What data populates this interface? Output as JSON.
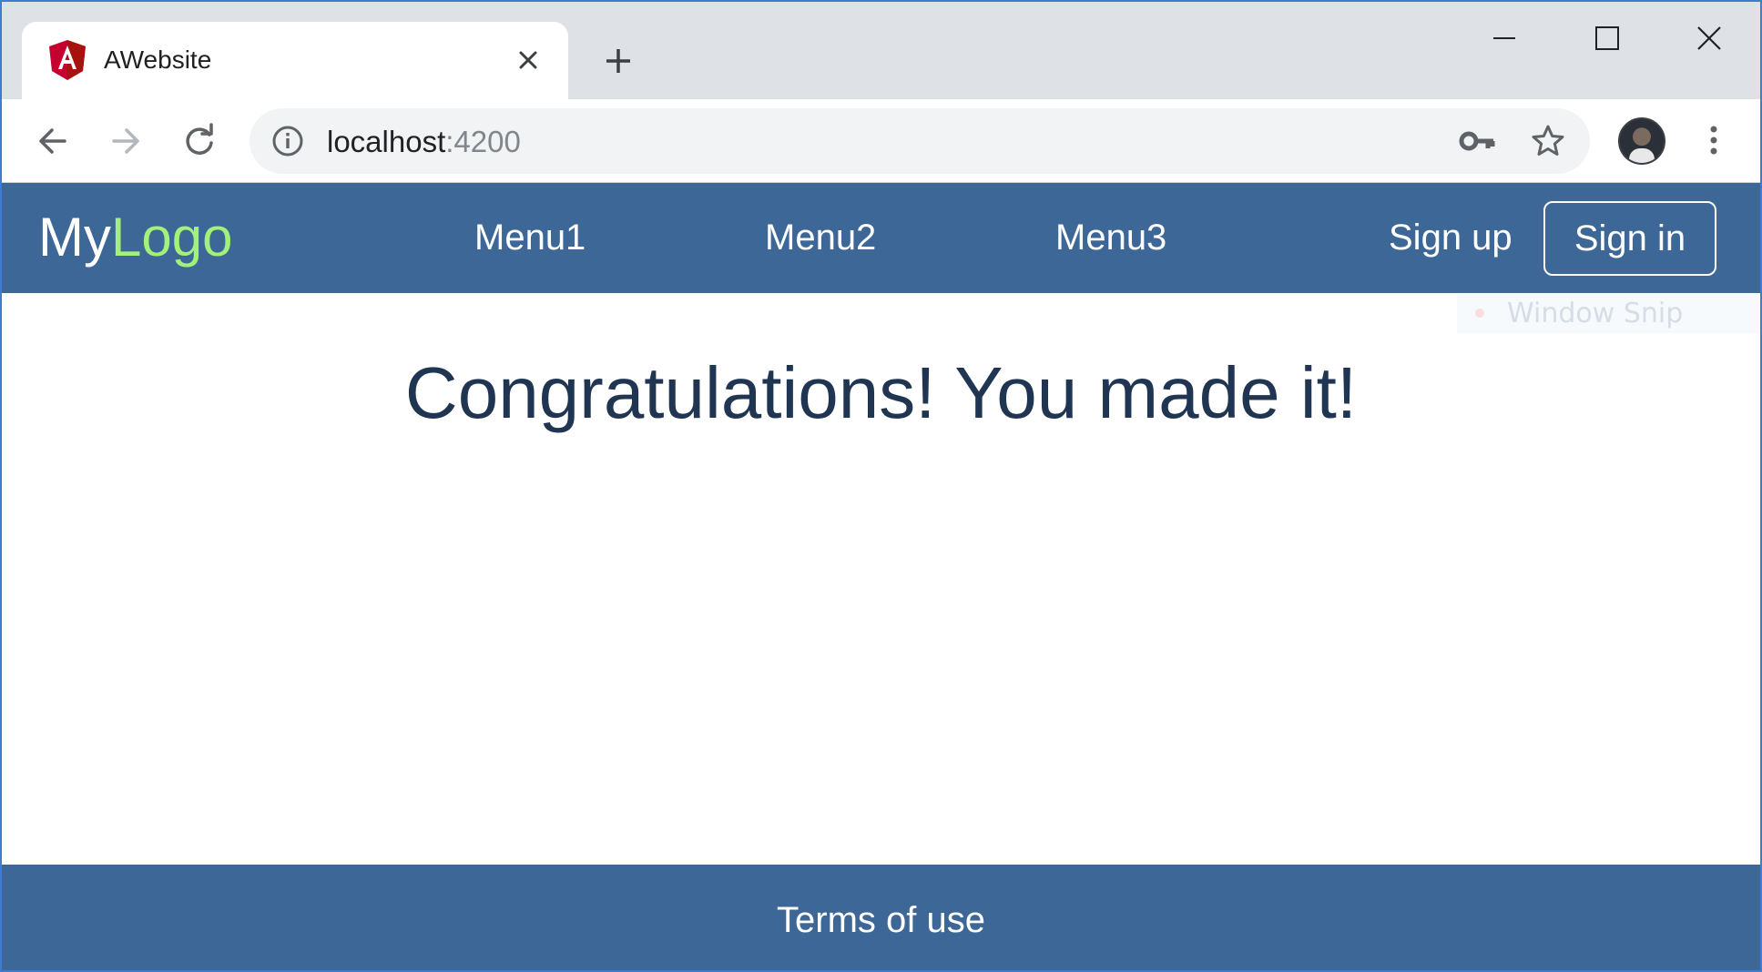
{
  "browser": {
    "tab": {
      "title": "AWebsite",
      "favicon": "angular-icon"
    },
    "address_bar": {
      "host": "localhost",
      "port": ":4200"
    },
    "toolbar_icons": [
      "back-arrow-icon",
      "forward-arrow-icon",
      "reload-icon",
      "info-icon",
      "key-icon",
      "star-icon",
      "kebab-menu-icon"
    ],
    "window_controls": [
      "minimize-icon",
      "maximize-icon",
      "close-icon"
    ]
  },
  "app": {
    "logo": {
      "part1": "My",
      "part2": "Logo",
      "part2_color": "#a3f07a"
    },
    "nav": {
      "menu1": "Menu1",
      "menu2": "Menu2",
      "menu3": "Menu3",
      "sign_up": "Sign up",
      "sign_in": "Sign in"
    },
    "brand_color": "#3d6796",
    "main": {
      "heading": "Congratulations! You made it!"
    },
    "footer": {
      "terms": "Terms of use"
    }
  },
  "overlay": {
    "snip_label": "Window Snip"
  }
}
